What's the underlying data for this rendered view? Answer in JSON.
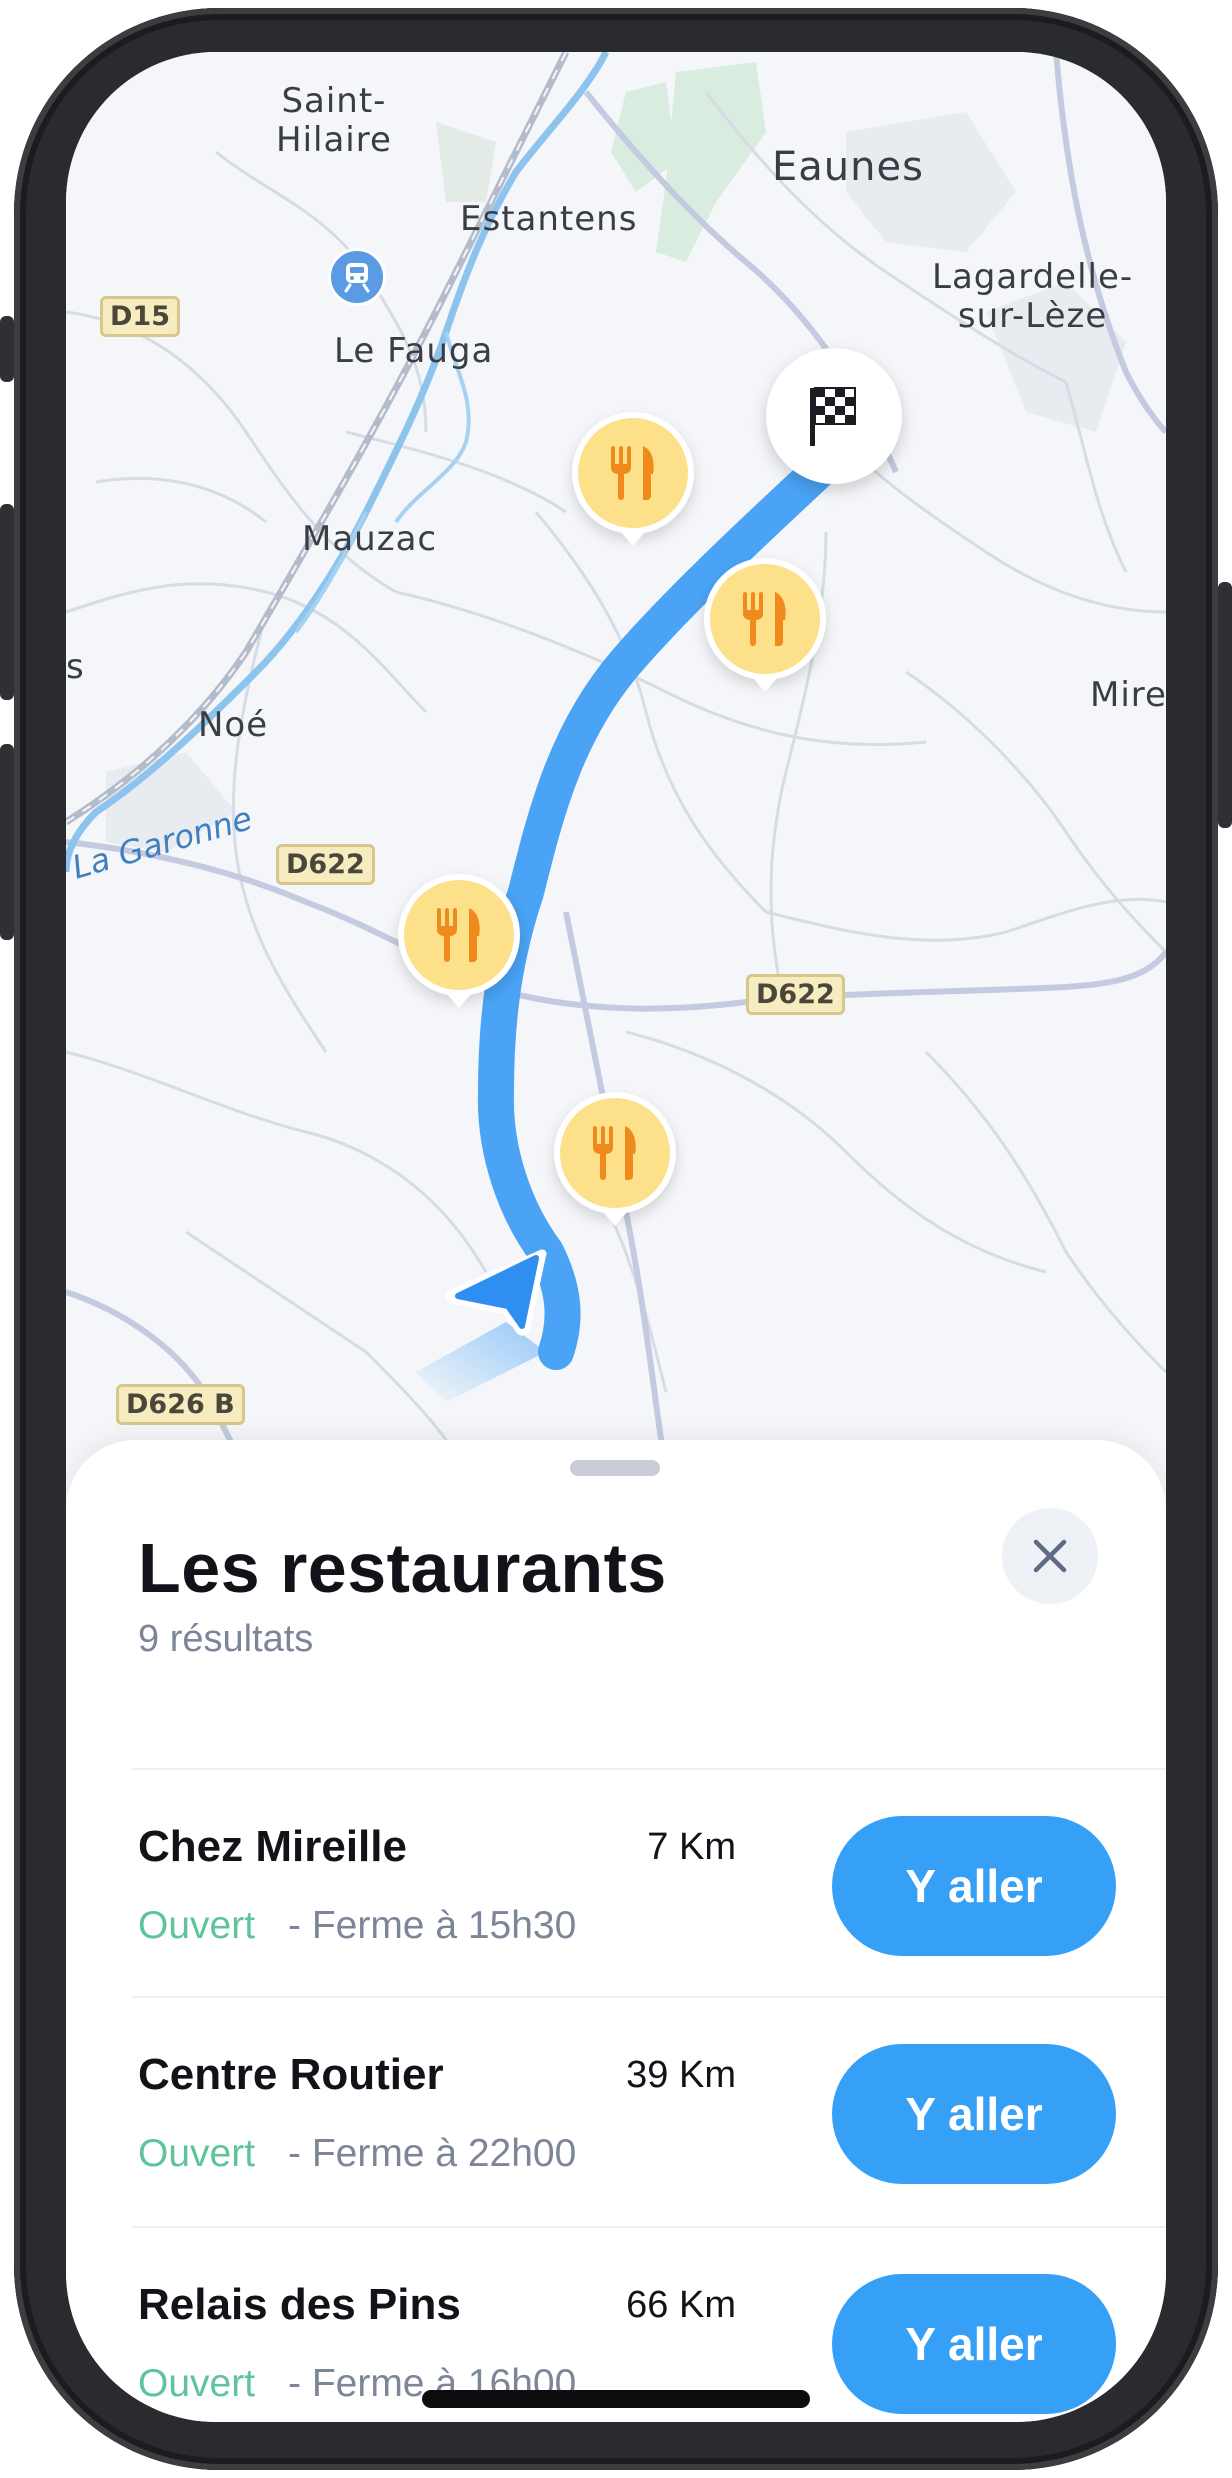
{
  "map": {
    "places": {
      "saint_hilaire": "Saint-\nHilaire",
      "estantens": "Estantens",
      "eaunes": "Eaunes",
      "lagardelle": "Lagardelle-\nsur-Lèze",
      "le_fauga": "Le Fauga",
      "mauzac": "Mauzac",
      "noe": "Noé",
      "mire": "Mire",
      "edge_s": "s"
    },
    "river": "La Garonne",
    "roads": {
      "d15": "D15",
      "d622_left": "D622",
      "d622_right": "D622",
      "d626b": "D626 B"
    },
    "icons": {
      "restaurant": "fork-knife-icon",
      "destination": "checkered-flag-icon",
      "train": "train-station-icon",
      "position": "navigation-arrow-icon"
    },
    "colors": {
      "route": "#4aa3f5",
      "poi": "#fde08a",
      "poi_icon": "#f08a1d"
    }
  },
  "sheet": {
    "title": "Les restaurants",
    "count": "9 résultats",
    "close_icon": "close-icon"
  },
  "restaurants": [
    {
      "name": "Chez Mireille",
      "distance": "7 Km",
      "status": "Ouvert",
      "hours": "- Ferme à 15h30",
      "action": "Y aller"
    },
    {
      "name": "Centre Routier",
      "distance": "39 Km",
      "status": "Ouvert",
      "hours": "- Ferme à 22h00",
      "action": "Y aller"
    },
    {
      "name": "Relais des Pins",
      "distance": "66 Km",
      "status": "Ouvert",
      "hours": "- Ferme à 16h00",
      "action": "Y aller"
    }
  ],
  "colors": {
    "accent": "#36a0f7",
    "open": "#5fc49b",
    "muted": "#7d8699"
  }
}
